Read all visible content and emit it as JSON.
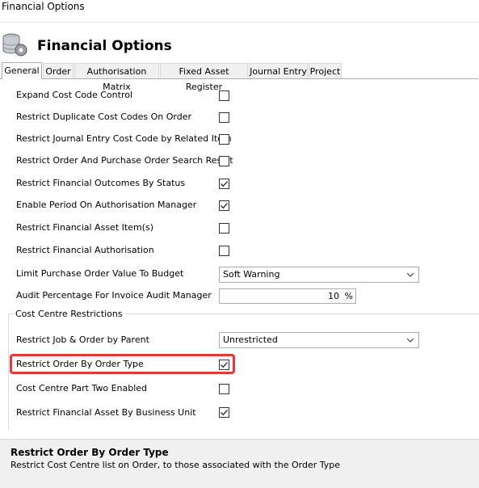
{
  "window": {
    "title": "Financial Options"
  },
  "header": {
    "title": "Financial Options",
    "icon": "database-gear-icon"
  },
  "tabs": [
    {
      "label": "General",
      "active": true
    },
    {
      "label": "Order",
      "active": false
    },
    {
      "label": "Authorisation Matrix",
      "active": false
    },
    {
      "label": "Fixed Asset Register",
      "active": false
    },
    {
      "label": "Journal Entry",
      "active": false
    },
    {
      "label": "Project",
      "active": false
    }
  ],
  "general": {
    "expand_cost_code": {
      "label": "Expand Cost Code Control",
      "checked": false
    },
    "restrict_duplicate_cost_codes": {
      "label": "Restrict Duplicate Cost Codes On Order",
      "checked": false
    },
    "restrict_journal_entry_cost_code": {
      "label": "Restrict Journal Entry Cost Code by Related Item",
      "checked": false
    },
    "restrict_order_po_search": {
      "label": "Restrict Order And Purchase Order Search Result",
      "checked": false
    },
    "restrict_financial_outcomes": {
      "label": "Restrict Financial Outcomes By Status",
      "checked": true
    },
    "enable_period_auth_manager": {
      "label": "Enable Period On Authorisation Manager",
      "checked": true
    },
    "restrict_financial_asset_items": {
      "label": "Restrict Financial Asset Item(s)",
      "checked": false
    },
    "restrict_financial_authorisation": {
      "label": "Restrict Financial Authorisation",
      "checked": false
    },
    "limit_po_value": {
      "label": "Limit Purchase Order Value To Budget",
      "value": "Soft Warning"
    },
    "audit_percentage": {
      "label": "Audit Percentage For Invoice Audit Manager",
      "value": "10",
      "unit": "%"
    }
  },
  "cost_centre": {
    "group_title": "Cost Centre Restrictions",
    "restrict_job_order_by_parent": {
      "label": "Restrict Job & Order by Parent",
      "value": "Unrestricted"
    },
    "restrict_order_by_type": {
      "label": "Restrict Order By Order Type",
      "checked": true
    },
    "cost_centre_part_two": {
      "label": "Cost Centre Part Two Enabled",
      "checked": false
    },
    "restrict_asset_by_bu": {
      "label": "Restrict Financial Asset By Business Unit",
      "checked": true
    }
  },
  "help": {
    "title": "Restrict Order By Order Type",
    "text": "Restrict Cost Centre list on Order, to those associated with the Order Type"
  },
  "colors": {
    "highlight": "#e03a3a",
    "help_bg": "#f0f0f0"
  }
}
